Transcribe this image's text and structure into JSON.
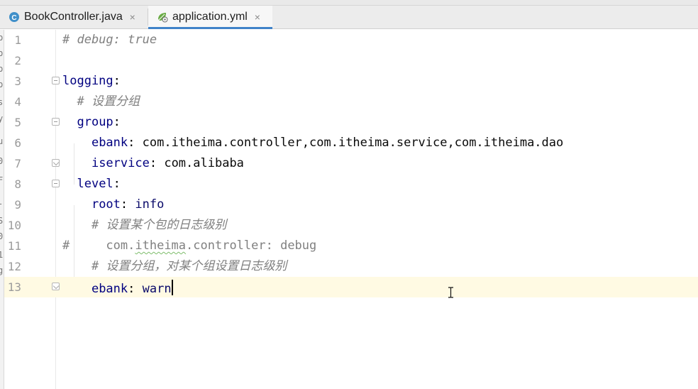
{
  "tabs": [
    {
      "label": "BookController.java",
      "icon": "java-class-icon",
      "active": false
    },
    {
      "label": "application.yml",
      "icon": "spring-yaml-icon",
      "active": true
    }
  ],
  "tab_close_glyph": "×",
  "left_panel_fragments": [
    "b",
    "b",
    "b",
    "b",
    "s",
    "y",
    "u",
    "0",
    "F",
    "-",
    "S",
    "0",
    "1",
    "g"
  ],
  "editor": {
    "current_line": 13,
    "lines": [
      {
        "number": "1",
        "comment": "# debug: true"
      },
      {
        "number": "2"
      },
      {
        "number": "3",
        "key": "logging",
        "sep": ":"
      },
      {
        "number": "4",
        "indent": "  ",
        "comment": "# 设置分组"
      },
      {
        "number": "5",
        "indent": "  ",
        "key": "group",
        "sep": ":"
      },
      {
        "number": "6",
        "indent": "    ",
        "key": "ebank",
        "sep": ": ",
        "value": "com.itheima.controller,com.itheima.service,com.itheima.dao"
      },
      {
        "number": "7",
        "indent": "    ",
        "key": "iservice",
        "sep": ": ",
        "value": "com.alibaba"
      },
      {
        "number": "8",
        "indent": "  ",
        "key": "level",
        "sep": ":"
      },
      {
        "number": "9",
        "indent": "    ",
        "key": "root",
        "sep": ": ",
        "value": "info"
      },
      {
        "number": "10",
        "indent": "    ",
        "comment": "# 设置某个包的日志级别"
      },
      {
        "number": "11",
        "comment_hash": "#",
        "commented_pre": "     com.",
        "commented_wavy": "itheima",
        "commented_post": ".controller: debug"
      },
      {
        "number": "12",
        "indent": "    ",
        "comment": "# 设置分组，对某个组设置日志级别"
      },
      {
        "number": "13",
        "indent": "    ",
        "key": "ebank",
        "sep": ": ",
        "value": "warn"
      }
    ]
  },
  "colors": {
    "key": "#000080",
    "comment": "#808080",
    "current_line": "#fffae3",
    "tab_underline": "#4083c9"
  }
}
